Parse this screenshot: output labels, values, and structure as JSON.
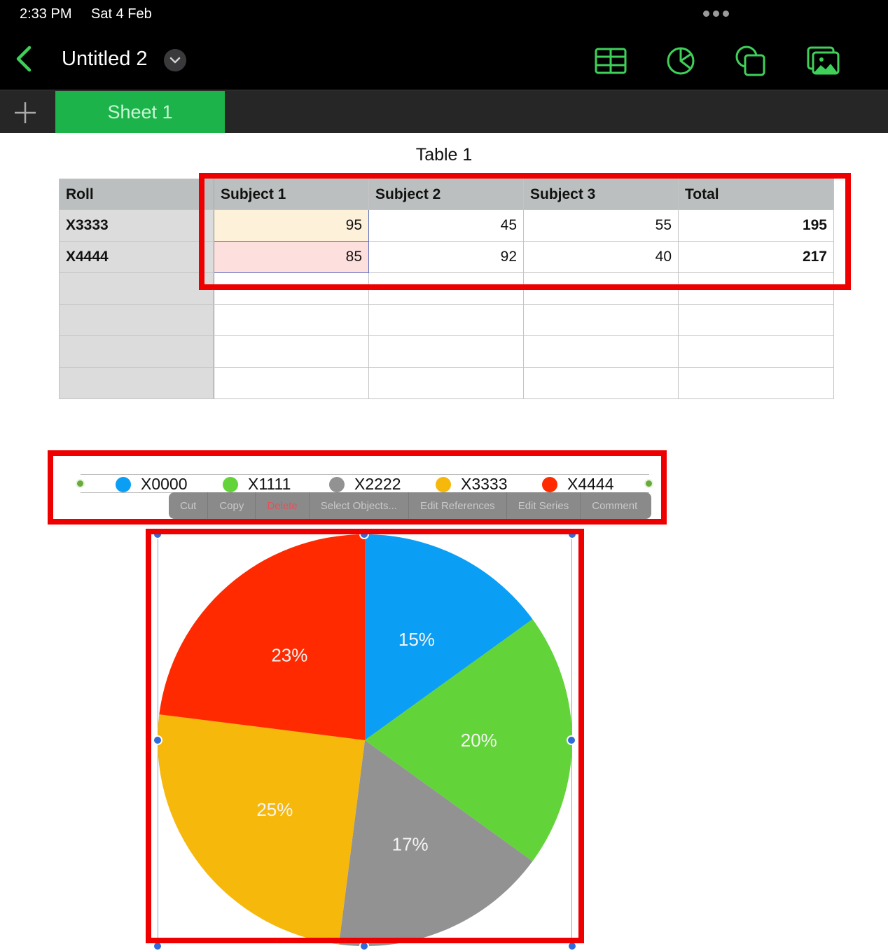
{
  "status_bar": {
    "time": "2:33 PM",
    "date": "Sat 4 Feb"
  },
  "toolbar": {
    "back_icon": "chevron-left-icon",
    "title": "Untitled 2",
    "title_menu_icon": "chevron-down-icon",
    "tools": [
      {
        "name": "insert-table",
        "icon": "table-icon"
      },
      {
        "name": "insert-chart",
        "icon": "pie-chart-icon"
      },
      {
        "name": "insert-shape",
        "icon": "shapes-icon"
      },
      {
        "name": "insert-media",
        "icon": "photo-icon"
      }
    ],
    "accent_color": "#3fd05a"
  },
  "sheets": {
    "add_icon": "plus-icon",
    "tabs": [
      {
        "label": "Sheet 1",
        "active": true
      }
    ]
  },
  "table": {
    "title": "Table 1",
    "headers": [
      "Roll",
      "Subject 1",
      "Subject 2",
      "Subject 3",
      "Total"
    ],
    "rows": [
      [
        "X3333",
        "95",
        "45",
        "55",
        "195"
      ],
      [
        "X4444",
        "85",
        "92",
        "40",
        "217"
      ],
      [
        "",
        "",
        "",
        "",
        ""
      ],
      [
        "",
        "",
        "",
        "",
        ""
      ],
      [
        "",
        "",
        "",
        "",
        ""
      ],
      [
        "",
        "",
        "",
        "",
        ""
      ]
    ]
  },
  "context_menu": {
    "items": [
      "Cut",
      "Copy",
      "Delete",
      "Select Objects...",
      "Edit References",
      "Edit Series",
      "Comment"
    ]
  },
  "chart_data": {
    "type": "pie",
    "title": "",
    "legend_placement": "top",
    "categories": [
      "X0000",
      "X1111",
      "X2222",
      "X3333",
      "X4444"
    ],
    "values": [
      15,
      20,
      17,
      25,
      23
    ],
    "labels": [
      "15%",
      "20%",
      "17%",
      "25%",
      "23%"
    ],
    "colors": [
      "#0a9ff5",
      "#62d43a",
      "#929292",
      "#f7b80c",
      "#ff2a00"
    ],
    "start": "top",
    "direction": "clockwise"
  },
  "highlight_color": "#ee0000"
}
